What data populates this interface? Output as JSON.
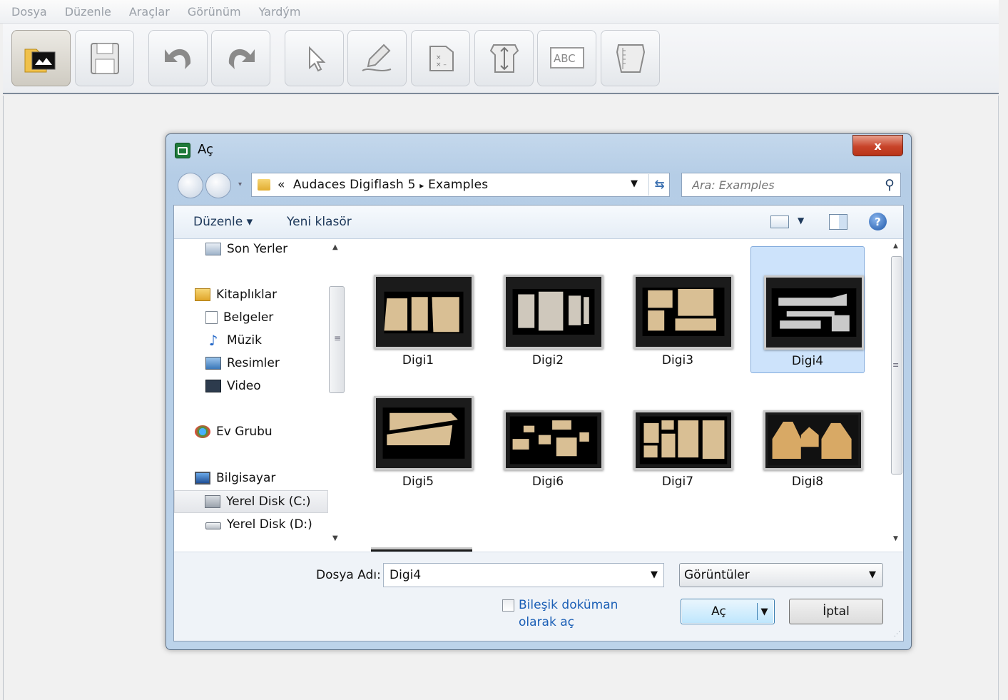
{
  "menubar": {
    "items": [
      {
        "label": "Dosya"
      },
      {
        "label": "Düzenle"
      },
      {
        "label": "Araçlar"
      },
      {
        "label": "Görünüm"
      },
      {
        "label": "Yardým"
      }
    ]
  },
  "toolbar": {
    "buttons": [
      {
        "icon": "open-folder-icon",
        "active": true
      },
      {
        "icon": "save-disk-icon"
      },
      {
        "icon": "undo-icon"
      },
      {
        "icon": "redo-icon"
      },
      {
        "icon": "select-arrow-icon"
      },
      {
        "icon": "pen-draw-icon"
      },
      {
        "icon": "piece-marker-icon"
      },
      {
        "icon": "grain-line-icon"
      },
      {
        "text": "ABC",
        "icon": "text-label-icon"
      },
      {
        "icon": "measure-piece-icon"
      }
    ]
  },
  "dialog": {
    "title": "Aç",
    "close_label": "x",
    "address": {
      "prefix": "«",
      "crumbs": [
        "Audaces Digiflash 5",
        "Examples"
      ],
      "separator": "▸"
    },
    "search_placeholder": "Ara: Examples",
    "command_bar": {
      "organize_label": "Düzenle ▾",
      "new_folder_label": "Yeni klasör",
      "help_label": "?"
    },
    "nav_pane": {
      "items": [
        {
          "label": "Son Yerler",
          "icon": "recent-places-icon"
        },
        {
          "label": "Kitaplıklar",
          "icon": "libraries-icon"
        },
        {
          "label": "Belgeler",
          "icon": "documents-icon"
        },
        {
          "label": "Müzik",
          "icon": "music-icon"
        },
        {
          "label": "Resimler",
          "icon": "pictures-icon"
        },
        {
          "label": "Video",
          "icon": "video-icon"
        },
        {
          "label": "Ev Grubu",
          "icon": "homegroup-icon"
        },
        {
          "label": "Bilgisayar",
          "icon": "computer-icon"
        },
        {
          "label": "Yerel Disk (C:)",
          "icon": "system-drive-icon",
          "selected": true
        },
        {
          "label": "Yerel Disk (D:)",
          "icon": "drive-icon"
        }
      ]
    },
    "files": [
      {
        "name": "Digi1"
      },
      {
        "name": "Digi2"
      },
      {
        "name": "Digi3"
      },
      {
        "name": "Digi4",
        "selected": true
      },
      {
        "name": "Digi5"
      },
      {
        "name": "Digi6"
      },
      {
        "name": "Digi7"
      },
      {
        "name": "Digi8"
      }
    ],
    "filename_label": "Dosya Adı:",
    "filename_value": "Digi4",
    "filetype_value": "Görüntüler",
    "compound_label": "Bileşik doküman olarak aç",
    "compound_checked": false,
    "open_label": "Aç",
    "cancel_label": "İptal",
    "colors": {
      "selection": "#cde3fb",
      "link": "#1b5fb6",
      "close_button": "#c8442a"
    }
  }
}
